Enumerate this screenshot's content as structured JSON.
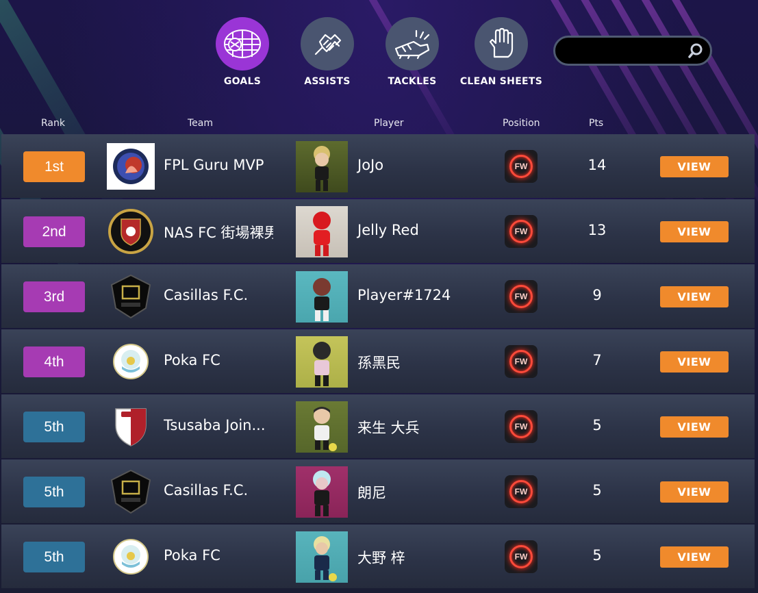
{
  "categories": [
    {
      "label": "GOALS",
      "icon": "goal-net-icon",
      "active": true
    },
    {
      "label": "ASSISTS",
      "icon": "handshake-icon",
      "active": false
    },
    {
      "label": "TACKLES",
      "icon": "boot-tackle-icon",
      "active": false
    },
    {
      "label": "CLEAN SHEETS",
      "icon": "goalkeeper-glove-icon",
      "active": false
    }
  ],
  "search": {
    "placeholder": "",
    "value": "",
    "icon": "search-icon"
  },
  "columns": {
    "rank": "Rank",
    "team": "Team",
    "player": "Player",
    "position": "Position",
    "pts": "Pts"
  },
  "colors": {
    "rank_gold": "#f08a2c",
    "rank_purple": "#a63bb3",
    "rank_blue": "#2e7198",
    "view_button": "#f08a2c",
    "active_category": "#9a35d6"
  },
  "rows": [
    {
      "rank": "1st",
      "team": "FPL Guru MVP",
      "player": "JoJo",
      "position": "FW",
      "pts": "14",
      "view": "VIEW"
    },
    {
      "rank": "2nd",
      "team": "NAS FC 街場裸男",
      "player": "Jelly Red",
      "position": "FW",
      "pts": "13",
      "view": "VIEW"
    },
    {
      "rank": "3rd",
      "team": "Casillas F.C.",
      "player": "Player#1724",
      "position": "FW",
      "pts": "9",
      "view": "VIEW"
    },
    {
      "rank": "4th",
      "team": "Poka FC",
      "player": "孫黑民",
      "position": "FW",
      "pts": "7",
      "view": "VIEW"
    },
    {
      "rank": "5th",
      "team": "Tsusaba Join...",
      "player": "来生 大兵",
      "position": "FW",
      "pts": "5",
      "view": "VIEW"
    },
    {
      "rank": "5th",
      "team": "Casillas F.C.",
      "player": "朗尼",
      "position": "FW",
      "pts": "5",
      "view": "VIEW"
    },
    {
      "rank": "5th",
      "team": "Poka FC",
      "player": "大野 梓",
      "position": "FW",
      "pts": "5",
      "view": "VIEW"
    }
  ]
}
